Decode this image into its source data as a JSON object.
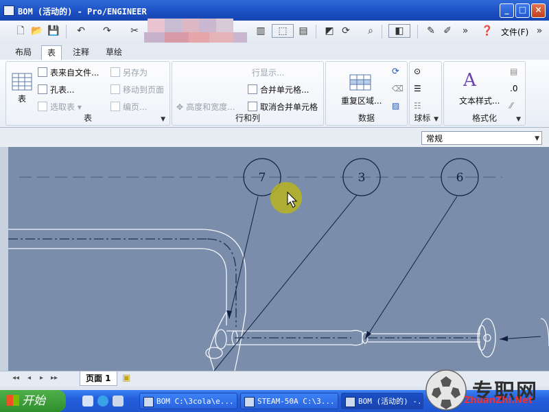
{
  "window": {
    "title": "BOM (活动的) - Pro/ENGINEER",
    "controls": [
      "_",
      "□",
      "×"
    ]
  },
  "toolbar": {
    "file_menu": "文件(F)",
    "more": "»"
  },
  "tabs": [
    "布局",
    "表",
    "注释",
    "草绘"
  ],
  "ribbon": {
    "table_group": {
      "label": "表",
      "big_button": "表",
      "items": [
        "表来自文件...",
        "孔表...",
        "选取表",
        "另存为",
        "移动到页面",
        "编页..."
      ]
    },
    "rows_cols_group": {
      "label": "行和列",
      "items": [
        "高度和宽度...",
        "行显示...",
        "合并单元格...",
        "取消合并单元格"
      ]
    },
    "data_group": {
      "label": "数据",
      "big_button": "重复区域..."
    },
    "balloon_group": {
      "label": "球标"
    },
    "format_group": {
      "label": "格式化",
      "big_button": "文本样式..."
    }
  },
  "style_select": {
    "value": "常规"
  },
  "drawing": {
    "balloons": [
      "7",
      "3",
      "6"
    ]
  },
  "pagebar": {
    "page_tab": "页面 1"
  },
  "taskbar": {
    "start": "开始",
    "tasks": [
      "BOM C:\\3cola\\e...",
      "STEAM-50A C:\\3...",
      "BOM (活动的) -..."
    ]
  },
  "watermark": {
    "text": "专职网",
    "url": "ZhuanZhi.Net"
  },
  "colors": {
    "canvas": "#7a8daa",
    "titlebar": "#1b4fc2",
    "taskbar": "#245edb",
    "start": "#3a9a36"
  }
}
